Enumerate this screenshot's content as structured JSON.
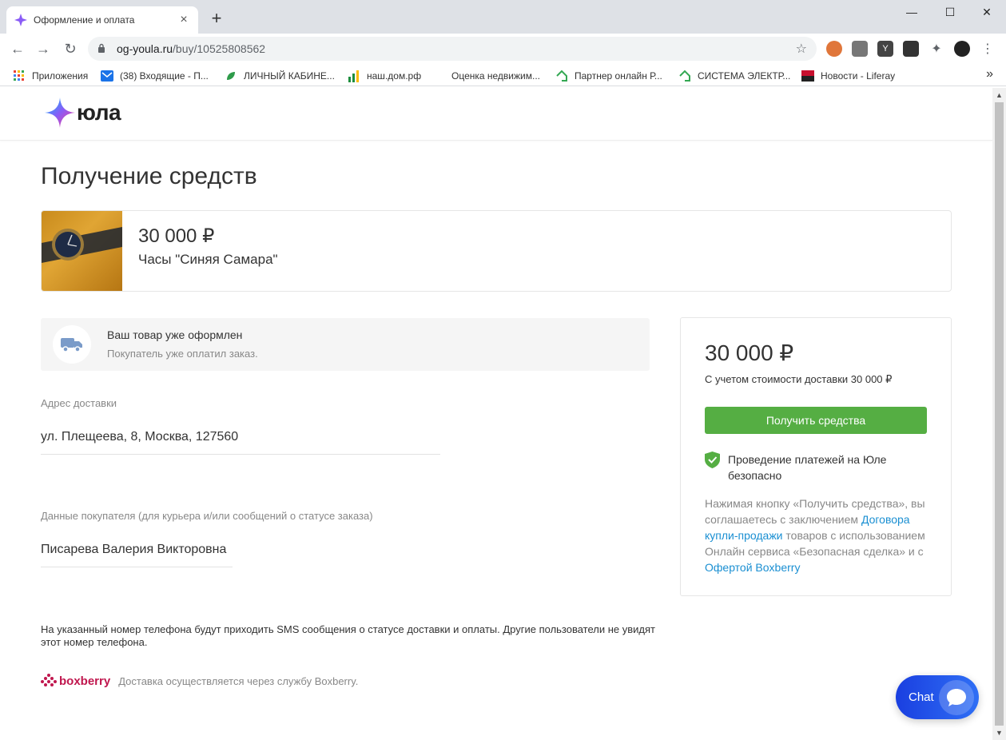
{
  "browser": {
    "tab_title": "Оформление и оплата",
    "url_host": "og-youla.ru",
    "url_path": "/buy/10525808562",
    "bookmarks": [
      {
        "label": "Приложения",
        "icon": "apps-grid-icon",
        "color": "#ea4335"
      },
      {
        "label": "(38) Входящие - П...",
        "icon": "mail-icon",
        "color": "#1a73e8"
      },
      {
        "label": "ЛИЧНЫЙ КАБИНЕ...",
        "icon": "leaf-icon",
        "color": "#2e9b4a"
      },
      {
        "label": "наш.дом.рф",
        "icon": "bars-icon",
        "color": "#1e8e3e"
      },
      {
        "label": "Оценка недвижим...",
        "icon": "blank-icon",
        "color": "#ffffff"
      },
      {
        "label": "Партнер онлайн Р...",
        "icon": "house-icon",
        "color": "#34a853"
      },
      {
        "label": "СИСТЕМА ЭЛЕКТР...",
        "icon": "house-icon",
        "color": "#34a853"
      },
      {
        "label": "Новости - Liferay",
        "icon": "liferay-icon",
        "color": "#c8102e"
      }
    ]
  },
  "site": {
    "brand": "юла"
  },
  "page": {
    "title": "Получение средств",
    "product": {
      "price": "30 000 ₽",
      "name": "Часы \"Синяя Самара\""
    },
    "notice": {
      "title": "Ваш товар уже оформлен",
      "text": "Покупатель уже оплатил заказ."
    },
    "address": {
      "label": "Адрес доставки",
      "value": "ул. Плещеева, 8, Москва, 127560"
    },
    "buyer": {
      "label": "Данные покупателя (для курьера и/или сообщений о статусе заказа)",
      "value": "Писарева Валерия Викторовна"
    },
    "sms_note": "На указанный номер телефона будут приходить SMS сообщения о статусе доставки и оплаты. Другие пользователи не увидят этот номер телефона.",
    "boxberry": {
      "brand": "boxberry",
      "text": "Доставка осуществляется через службу Boxberry."
    }
  },
  "summary": {
    "price": "30 000 ₽",
    "delivery": "С учетом стоимости доставки 30 000 ₽",
    "button": "Получить средства",
    "safe": "Проведение платежей на Юле безопасно",
    "legal_1": "Нажимая кнопку «Получить средства», вы соглашаетесь с заключением ",
    "legal_link_1": "Договора купли-продажи",
    "legal_2": " товаров с использованием Онлайн сервиса «Безопасная сделка» и с ",
    "legal_link_2": "Офертой Boxberry"
  },
  "chat": {
    "label": "Chat"
  },
  "colors": {
    "accent_green": "#55ae43",
    "link_blue": "#1a8fd2",
    "chat_blue": "#1a3fe0",
    "boxberry_red": "#c0174e"
  }
}
